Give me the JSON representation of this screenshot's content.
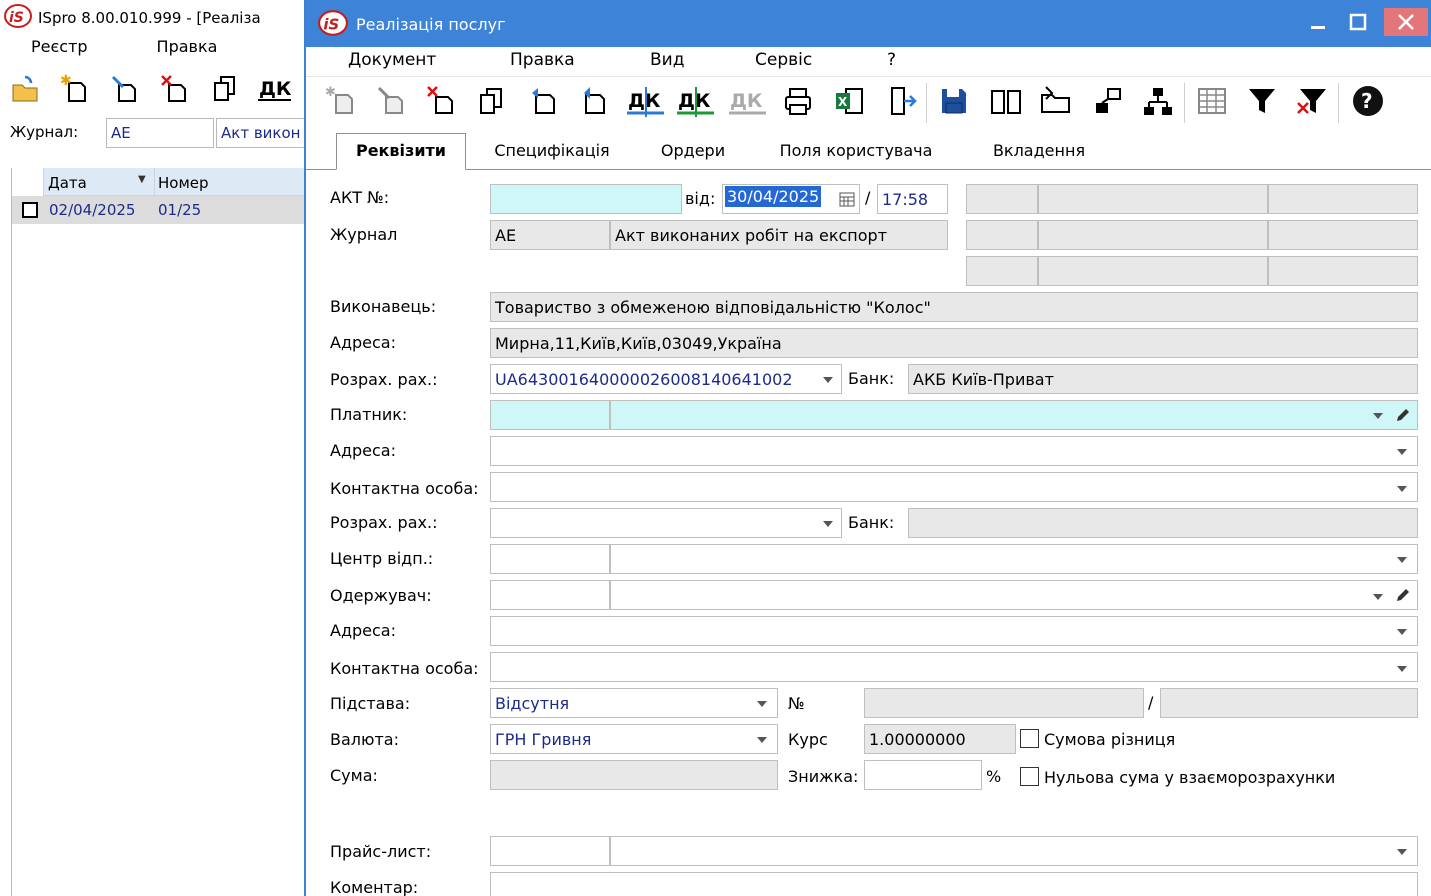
{
  "background_window": {
    "title": "ISpro 8.00.010.999 - [Реаліза",
    "menu": [
      "Реєстр",
      "Правка"
    ],
    "journal_label": "Журнал:",
    "journal_code": "АЕ",
    "journal_name": "Акт викон",
    "grid": {
      "columns": [
        "Дата",
        "Номер"
      ],
      "rows": [
        {
          "date": "02/04/2025",
          "number": "01/25"
        }
      ]
    },
    "toolbar_icons": [
      "open-folder-icon",
      "new-doc-icon",
      "edit-doc-icon",
      "delete-doc-icon",
      "copy-icon",
      "dk-icon"
    ]
  },
  "dialog": {
    "title": "Реалізація послуг",
    "window_controls": [
      "minimize",
      "maximize",
      "close"
    ],
    "menu": [
      "Документ",
      "Правка",
      "Вид",
      "Сервіс",
      "?"
    ],
    "toolbar_icons": [
      "new-doc-icon",
      "edit-doc-icon",
      "delete-doc-icon",
      "copy-icon",
      "return-icon",
      "export-icon",
      "dk-icon",
      "dk-green-icon",
      "dk-gray-icon",
      "print-icon",
      "excel-icon",
      "exit-icon",
      "save-icon",
      "book-icon",
      "folder-icon",
      "link-icon",
      "tree-icon",
      "grid-icon",
      "filter-icon",
      "clear-filter-icon",
      "help-icon"
    ],
    "tabs": [
      "Реквізити",
      "Специфікація",
      "Ордери",
      "Поля користувача",
      "Вкладення"
    ],
    "active_tab": "Реквізити",
    "form": {
      "act_label": "АКТ №:",
      "act_number": "",
      "from_label": "від:",
      "date": "30/04/2025",
      "time_sep": "/",
      "time": "17:58",
      "journal_label": "Журнал",
      "journal_code": "АЕ",
      "journal_name": "Акт виконаних робіт на експорт",
      "executor_label": "Виконавець:",
      "executor": "Товариство з обмеженою відповідальністю \"Колос\"",
      "address_label": "Адреса:",
      "executor_address": "Мирна,11,Київ,Київ,03049,Україна",
      "account_label": "Розрах. рах.:",
      "executor_account": "UA643001640000026008140641002",
      "bank_label": "Банк:",
      "executor_bank": "АКБ Київ-Приват",
      "payer_label": "Платник:",
      "payer_address_label": "Адреса:",
      "contact_label": "Контактна особа:",
      "payer_account_label": "Розрах. рах.:",
      "payer_bank_label": "Банк:",
      "center_label": "Центр відп.:",
      "receiver_label": "Одержувач:",
      "receiver_address_label": "Адреса:",
      "receiver_contact_label": "Контактна особа:",
      "basis_label": "Підстава:",
      "basis": "Відсутня",
      "no_label": "№",
      "slash": "/",
      "currency_label": "Валюта:",
      "currency": "ГРН Гривня",
      "rate_label": "Курс",
      "rate": "1.00000000",
      "sum_diff_label": "Сумова різниця",
      "sum_label": "Сума:",
      "discount_label": "Знижка:",
      "percent": "%",
      "zero_sum_label": "Нульова сума у взаєморозрахунки",
      "price_list_label": "Прайс-лист:",
      "comment_label": "Коментар:"
    }
  },
  "colors": {
    "title_bar": "#3d83d8",
    "close_button": "#e3767a",
    "required_field": "#cff7f7",
    "readonly_field": "#e8e8e8",
    "value_text": "#1c2a8c"
  }
}
